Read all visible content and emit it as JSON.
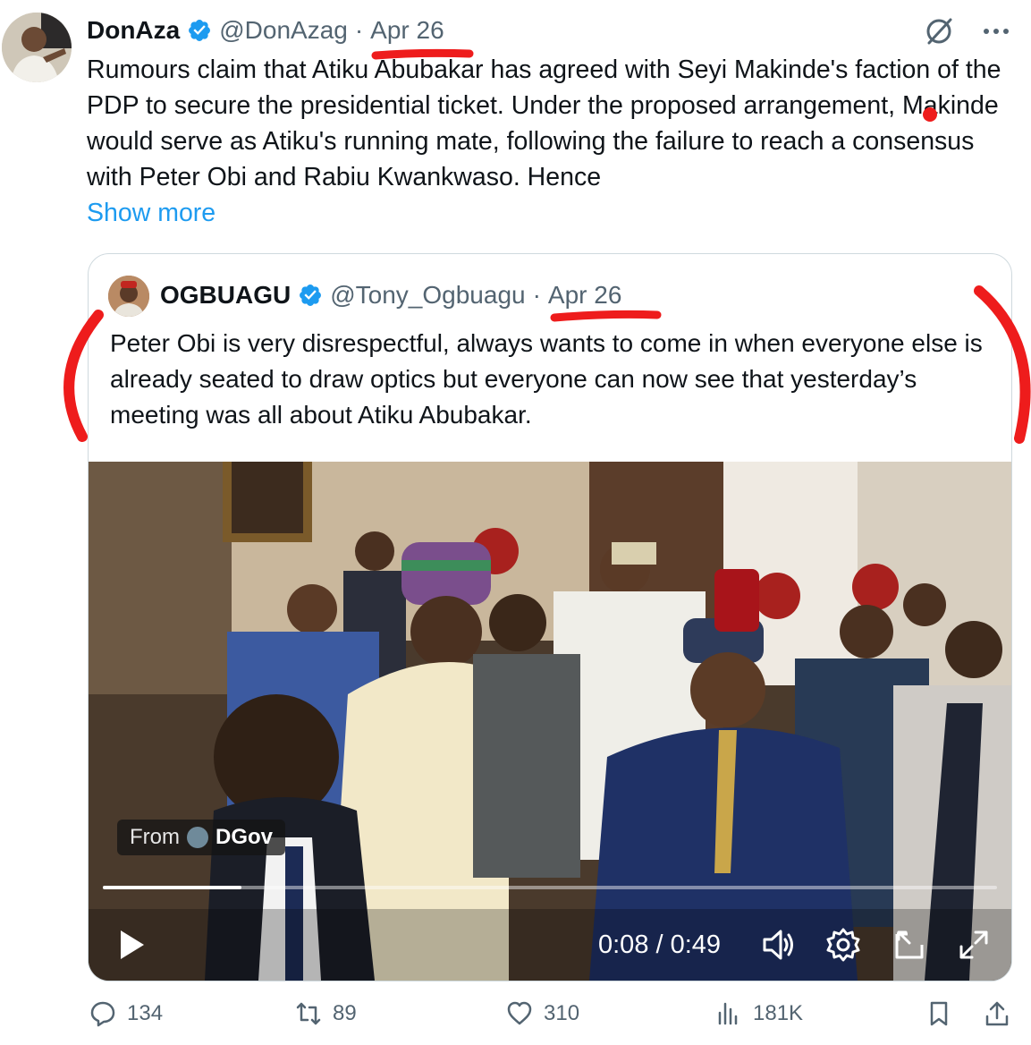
{
  "tweet": {
    "author_name": "DonAza",
    "author_handle": "@DonAzag",
    "separator": "·",
    "date": "Apr 26",
    "text": "Rumours claim that Atiku Abubakar has agreed with Seyi Makinde's faction of the PDP to secure the presidential ticket. Under the proposed arrangement, Makinde would serve as Atiku's running mate, following the failure to reach a consensus with Peter Obi and Rabiu Kwankwaso. Hence",
    "show_more": "Show more"
  },
  "quote": {
    "author_name": "OGBUAGU",
    "author_handle": "@Tony_Ogbuagu",
    "separator": "·",
    "date": "Apr 26",
    "text": "Peter Obi is very disrespectful, always wants to come in when everyone else is already seated to draw optics but everyone can now see that yesterday’s meeting was all about Atiku Abubakar.",
    "video": {
      "from_label": "From",
      "source_name": "DGov",
      "timecode": "0:08 / 0:49",
      "progress": 0.155
    }
  },
  "actions": {
    "replies": "134",
    "reposts": "89",
    "likes": "310",
    "views": "181K"
  },
  "colors": {
    "accent": "#1d9bf0",
    "verified": "#1d9bf0",
    "annotation": "#ee1c1c"
  },
  "icons": [
    "verified-badge-icon",
    "grok-icon",
    "more-icon",
    "play-icon",
    "volume-icon",
    "settings-icon",
    "pip-icon",
    "fullscreen-icon",
    "reply-icon",
    "repost-icon",
    "like-icon",
    "views-icon",
    "bookmark-icon",
    "share-icon"
  ]
}
